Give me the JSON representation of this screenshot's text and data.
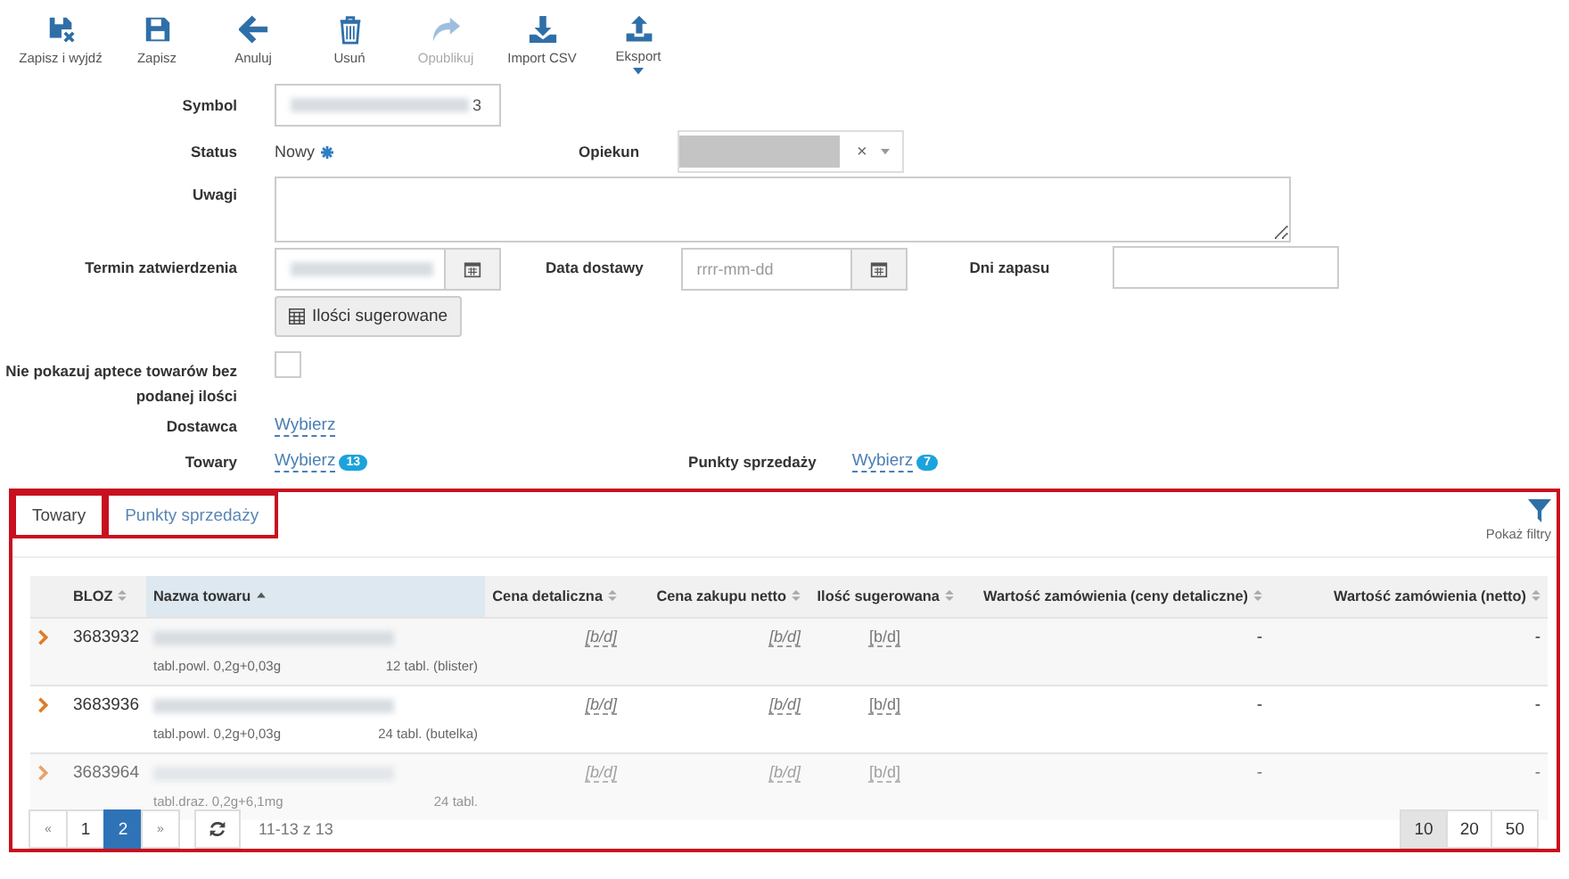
{
  "toolbar": [
    {
      "label": "Zapisz i wyjdź",
      "kind": "save-exit",
      "disabled": false,
      "has_menu": false
    },
    {
      "label": "Zapisz",
      "kind": "save",
      "disabled": false,
      "has_menu": false
    },
    {
      "label": "Anuluj",
      "kind": "back",
      "disabled": false,
      "has_menu": false
    },
    {
      "label": "Usuń",
      "kind": "trash",
      "disabled": false,
      "has_menu": false
    },
    {
      "label": "Opublikuj",
      "kind": "share",
      "disabled": true,
      "has_menu": false
    },
    {
      "label": "Import CSV",
      "kind": "download",
      "disabled": false,
      "has_menu": false
    },
    {
      "label": "Eksport",
      "kind": "upload",
      "disabled": false,
      "has_menu": true
    }
  ],
  "form": {
    "symbol": {
      "label": "Symbol",
      "value": "3",
      "redacted": true
    },
    "status": {
      "label": "Status",
      "value": "Nowy"
    },
    "opiekun": {
      "label": "Opiekun",
      "redacted": true,
      "clear": "×"
    },
    "uwagi": {
      "label": "Uwagi"
    },
    "termin": {
      "label": "Termin zatwierdzenia",
      "redacted": true
    },
    "data_dostawy": {
      "label": "Data dostawy",
      "placeholder": "rrrr-mm-dd"
    },
    "dni_zapasu": {
      "label": "Dni zapasu"
    },
    "suggest_button": "Ilości sugerowane",
    "hide_checkbox": {
      "label": "Nie pokazuj aptece towarów bez podanej ilości",
      "checked": false
    },
    "dostawca": {
      "label": "Dostawca",
      "link": "Wybierz"
    },
    "towary": {
      "label": "Towary",
      "link": "Wybierz",
      "badge": "13"
    },
    "punkty": {
      "label": "Punkty sprzedaży",
      "link": "Wybierz",
      "badge": "7"
    }
  },
  "panel": {
    "highlighted": true,
    "tabs": [
      {
        "label": "Towary",
        "selected": true,
        "highlighted": true
      },
      {
        "label": "Punkty sprzedaży",
        "selected": false,
        "highlighted": true
      }
    ],
    "filter_button": "Pokaż filtry",
    "table": {
      "columns": [
        {
          "label": "BLOZ",
          "sorted": false
        },
        {
          "label": "Nazwa towaru",
          "sorted": true
        },
        {
          "label": "Cena detaliczna",
          "sorted": false
        },
        {
          "label": "Cena zakupu netto",
          "sorted": false
        },
        {
          "label": "Ilość sugerowana",
          "sorted": false
        },
        {
          "label": "Wartość zamówienia (ceny detaliczne)",
          "sorted": false
        },
        {
          "label": "Wartość zamówienia (netto)",
          "sorted": false
        }
      ],
      "rows": [
        {
          "bloz": "3683932",
          "name_redacted": true,
          "form": "tabl.powl. 0,2g+0,03g",
          "pack": "12 tabl. (blister)",
          "cena_detaliczna": "[b/d]",
          "cena_zakupu": "[b/d]",
          "ilosc": "[b/d]",
          "wartosc_detal": "-",
          "wartosc_netto": "-",
          "faded": false
        },
        {
          "bloz": "3683936",
          "name_redacted": true,
          "form": "tabl.powl. 0,2g+0,03g",
          "pack": "24 tabl. (butelka)",
          "cena_detaliczna": "[b/d]",
          "cena_zakupu": "[b/d]",
          "ilosc": "[b/d]",
          "wartosc_detal": "-",
          "wartosc_netto": "-",
          "faded": false
        },
        {
          "bloz": "3683964",
          "name_redacted": true,
          "form": "tabl.draz. 0,2g+6,1mg",
          "pack": "24 tabl.",
          "cena_detaliczna": "[b/d]",
          "cena_zakupu": "[b/d]",
          "ilosc": "[b/d]",
          "wartosc_detal": "-",
          "wartosc_netto": "-",
          "faded": true
        }
      ]
    },
    "pagination": {
      "prev": "«",
      "pages": [
        {
          "label": "1",
          "selected": false
        },
        {
          "label": "2",
          "selected": true
        }
      ],
      "next": "»",
      "range": "11-13 z 13",
      "page_sizes": [
        {
          "label": "10",
          "selected": true
        },
        {
          "label": "20",
          "selected": false
        },
        {
          "label": "50",
          "selected": false
        }
      ]
    }
  }
}
